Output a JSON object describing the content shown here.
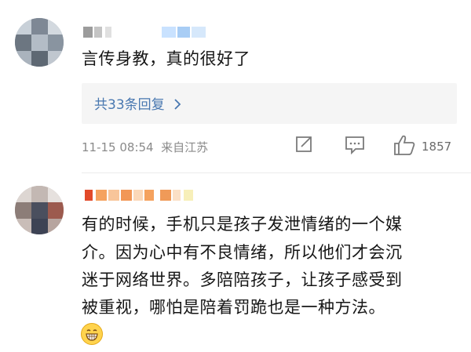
{
  "comment1": {
    "text": "言传身教，真的很好了",
    "replies_label": "共33条回复",
    "meta": "11-15 08:54  来自江苏",
    "like_count": "1857",
    "icons": [
      "avatar-blurred",
      "share-icon",
      "reply-icon",
      "like-icon",
      "chevron-right-icon"
    ]
  },
  "comment2": {
    "line1": "有的时候，手机只是孩子发泄情绪的一个媒",
    "line2": "介。因为心中有不良情绪，所以他们才会沉",
    "line3": "迷于网络世界。多陪陪孩子，让孩子感受到",
    "line4": "被重视，哪怕是陪着罚跪也是一种方法。",
    "emoji": "grin-emoji"
  },
  "colors": {
    "link": "#4877b0",
    "meta": "#8a8a8a",
    "reply_bg": "#f5f5f5",
    "username_orange": "#f5a25e",
    "username_red": "#e24a2a"
  }
}
